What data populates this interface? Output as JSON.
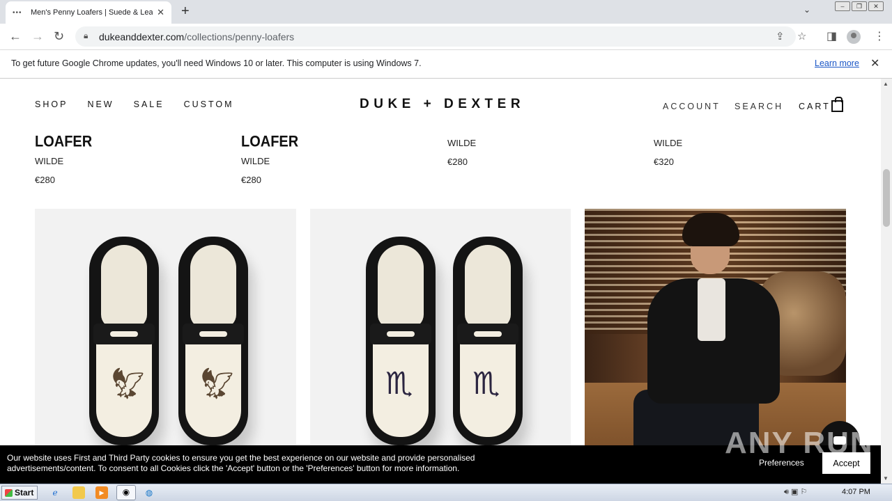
{
  "browser": {
    "tab_title": "Men's Penny Loafers | Suede & Leat",
    "tab_icon": "•••",
    "url_host": "dukeanddexter.com",
    "url_path": "/collections/penny-loafers",
    "new_tab": "+",
    "close": "✕"
  },
  "infobar": {
    "message": "To get future Google Chrome updates, you'll need Windows 10 or later. This computer is using Windows 7.",
    "learn_more": "Learn more"
  },
  "site": {
    "nav_left": [
      "SHOP",
      "NEW",
      "SALE",
      "CUSTOM"
    ],
    "logo": "DUKE + DEXTER",
    "nav_right": {
      "account": "ACCOUNT",
      "search": "SEARCH",
      "cart": "CART"
    }
  },
  "products": [
    {
      "title": "LOAFER",
      "brand": "WILDE",
      "price": "€280"
    },
    {
      "title": "LOAFER",
      "brand": "WILDE",
      "price": "€280"
    },
    {
      "title": "",
      "brand": "WILDE",
      "price": "€280"
    },
    {
      "title": "",
      "brand": "WILDE",
      "price": "€320"
    }
  ],
  "cookie": {
    "line1": "Our website uses First and Third Party cookies to ensure you get the best experience on our website and provide personalised",
    "line2": "advertisements/content. To consent to all Cookies click the 'Accept' button or the 'Preferences' button for more information.",
    "preferences": "Preferences",
    "accept": "Accept"
  },
  "watermark": "ANY RUN",
  "taskbar": {
    "start": "Start",
    "clock": "4:07 PM"
  },
  "colors": {
    "accent_link": "#1a56c6",
    "banner_bg": "#000000",
    "card_bg": "#f2f2f2"
  }
}
